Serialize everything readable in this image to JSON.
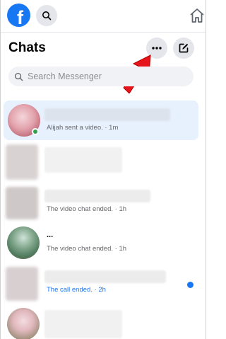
{
  "topbar": {
    "logo_letter": "f",
    "icons": {
      "search": "search-icon",
      "home": "home-icon"
    }
  },
  "header": {
    "title": "Chats",
    "more_icon": "more-dots-icon",
    "compose_icon": "compose-icon"
  },
  "search": {
    "placeholder": "Search Messenger"
  },
  "chats": [
    {
      "preview": "Alijah sent a video. · 1m",
      "online": true,
      "active": true
    },
    {
      "preview": ""
    },
    {
      "preview": "The video chat ended. · 1h"
    },
    {
      "name": "...",
      "preview": "The video chat ended. · 1h"
    },
    {
      "preview": "The call ended. · 2h",
      "unread": true
    },
    {
      "preview": ""
    }
  ],
  "colors": {
    "brand": "#1877f2",
    "online": "#31a24c",
    "annotation_arrow": "#e8141c"
  }
}
